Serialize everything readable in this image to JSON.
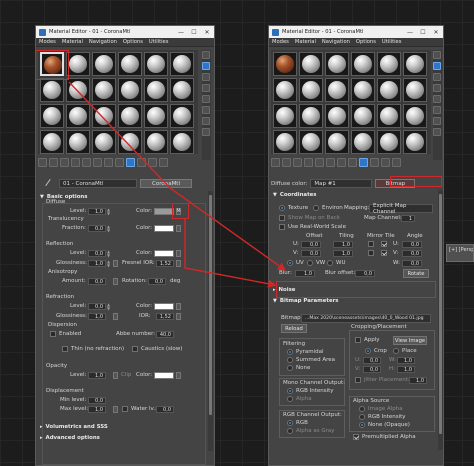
{
  "left_editor": {
    "title": "Material Editor - 01 - CoronaMtl",
    "window_controls": [
      "—",
      "☐",
      "✕"
    ],
    "menu": [
      "Modes",
      "Material",
      "Navigation",
      "Options",
      "Utilities"
    ],
    "material_name": "01 - CoronaMtl",
    "material_type": "CoronaMtl",
    "basic_options_header": "Basic options",
    "diffuse": {
      "section": "Diffuse",
      "level_label": "Level:",
      "level_value": "1,0",
      "color_label": "Color:",
      "map_btn": "M",
      "translucency_label": "Translucency",
      "fraction_label": "Fraction:",
      "fraction_value": "0,0"
    },
    "reflection": {
      "section": "Reflection",
      "level_label": "Level:",
      "level_value": "0,0",
      "color_label": "Color:",
      "glossiness_label": "Glossiness:",
      "glossiness_value": "1,0",
      "fresnel_label": "Fresnel IOR:",
      "fresnel_value": "1,52",
      "anisotropy_label": "Anisotropy",
      "amount_label": "Amount:",
      "amount_value": "0,0",
      "rotation_label": "Rotation:",
      "rotation_value": "0,0",
      "deg": "deg"
    },
    "refraction": {
      "section": "Refraction",
      "level_label": "Level:",
      "level_value": "0,0",
      "color_label": "Color:",
      "glossiness_label": "Glossiness:",
      "glossiness_value": "1,0",
      "ior_label": "IOR:",
      "ior_value": "1,52",
      "dispersion_label": "Dispersion",
      "enabled_label": "Enabled",
      "abbe_label": "Abbe number:",
      "abbe_value": "40,0",
      "thin_label": "Thin (no refraction)",
      "caustics_label": "Caustics (slow)"
    },
    "opacity": {
      "section": "Opacity",
      "level_label": "Level:",
      "level_value": "1,0",
      "color_label": "Color:",
      "clip_label": "Clip"
    },
    "displacement": {
      "section": "Displacement",
      "min_label": "Min level:",
      "min_value": "0,0",
      "max_label": "Max level:",
      "max_value": "1,0",
      "water_label": "Water lv.:",
      "water_value": "0,0"
    },
    "rollout_volumetrics": "Volumetrics and SSS",
    "rollout_advanced": "Advanced options",
    "colors": {
      "diffuse_swatch": "#9a9a9a",
      "white": "#ffffff",
      "black": "#000000"
    }
  },
  "right_editor": {
    "title": "Material Editor - 01 - CoronaMtl",
    "window_controls": [
      "—",
      "☐",
      "✕"
    ],
    "menu": [
      "Modes",
      "Material",
      "Navigation",
      "Options",
      "Utilities"
    ],
    "diffuse_color_label": "Diffuse color:",
    "map_name": "Map #1",
    "map_type": "Bitmap",
    "coordinates_header": "Coordinates",
    "texture_label": "Texture",
    "environ_label": "Environ",
    "mapping_label": "Mapping:",
    "mapping_value": "Explicit Map Channel",
    "show_map_label": "Show Map on Back",
    "map_channel_label": "Map Channel:",
    "map_channel_value": "1",
    "real_world_label": "Use Real-World Scale",
    "col_offset": "Offset",
    "col_tiling": "Tiling",
    "col_mirror_tile": "Mirror Tile",
    "col_angle": "Angle",
    "u_label": "U:",
    "u_offset": "0,0",
    "u_tiling": "1,0",
    "u_angle": "0,0",
    "v_label": "V:",
    "v_offset": "0,0",
    "v_tiling": "1,0",
    "v_angle": "0,0",
    "w_label": "W:",
    "w_angle": "0,0",
    "uv_label": "UV",
    "vw_label": "VW",
    "wu_label": "WU",
    "blur_label": "Blur:",
    "blur_value": "1,0",
    "blur_offset_label": "Blur offset:",
    "blur_offset_value": "0,0",
    "rotate_label": "Rotate",
    "noise_header": "Noise",
    "bitmap_params_header": "Bitmap Parameters",
    "bitmap_label": "Bitmap:",
    "bitmap_path": "...Max 2020\\sceneassets\\images\\40_0_Wood 01.jpg",
    "reload_label": "Reload",
    "cropping_header": "Cropping/Placement",
    "apply_label": "Apply",
    "view_image_label": "View Image",
    "crop_label": "Crop",
    "place_label": "Place",
    "crop_u_label": "U:",
    "crop_u_value": "0,0",
    "crop_w_label": "W:",
    "crop_w_value": "1,0",
    "crop_v_label": "V:",
    "crop_v_value": "0,0",
    "crop_h_label": "H:",
    "crop_h_value": "1,0",
    "jitter_label": "Jitter Placement:",
    "jitter_value": "1,0",
    "filtering_header": "Filtering",
    "pyramidal_label": "Pyramidal",
    "summed_area_label": "Summed Area",
    "none_label": "None",
    "mono_header": "Mono Channel Output:",
    "rgb_intensity_label": "RGB Intensity",
    "alpha_label": "Alpha",
    "rgb_channel_header": "RGB Channel Output:",
    "rgb_label": "RGB",
    "alpha_as_gray_label": "Alpha as Gray",
    "alpha_source_header": "Alpha Source",
    "image_alpha_label": "Image Alpha",
    "rgb_intensity2_label": "RGB Intensity",
    "none_opaque_label": "None (Opaque)",
    "premultiplied_label": "Premultiplied Alpha"
  },
  "viewport_label": "[+] [Perspective"
}
